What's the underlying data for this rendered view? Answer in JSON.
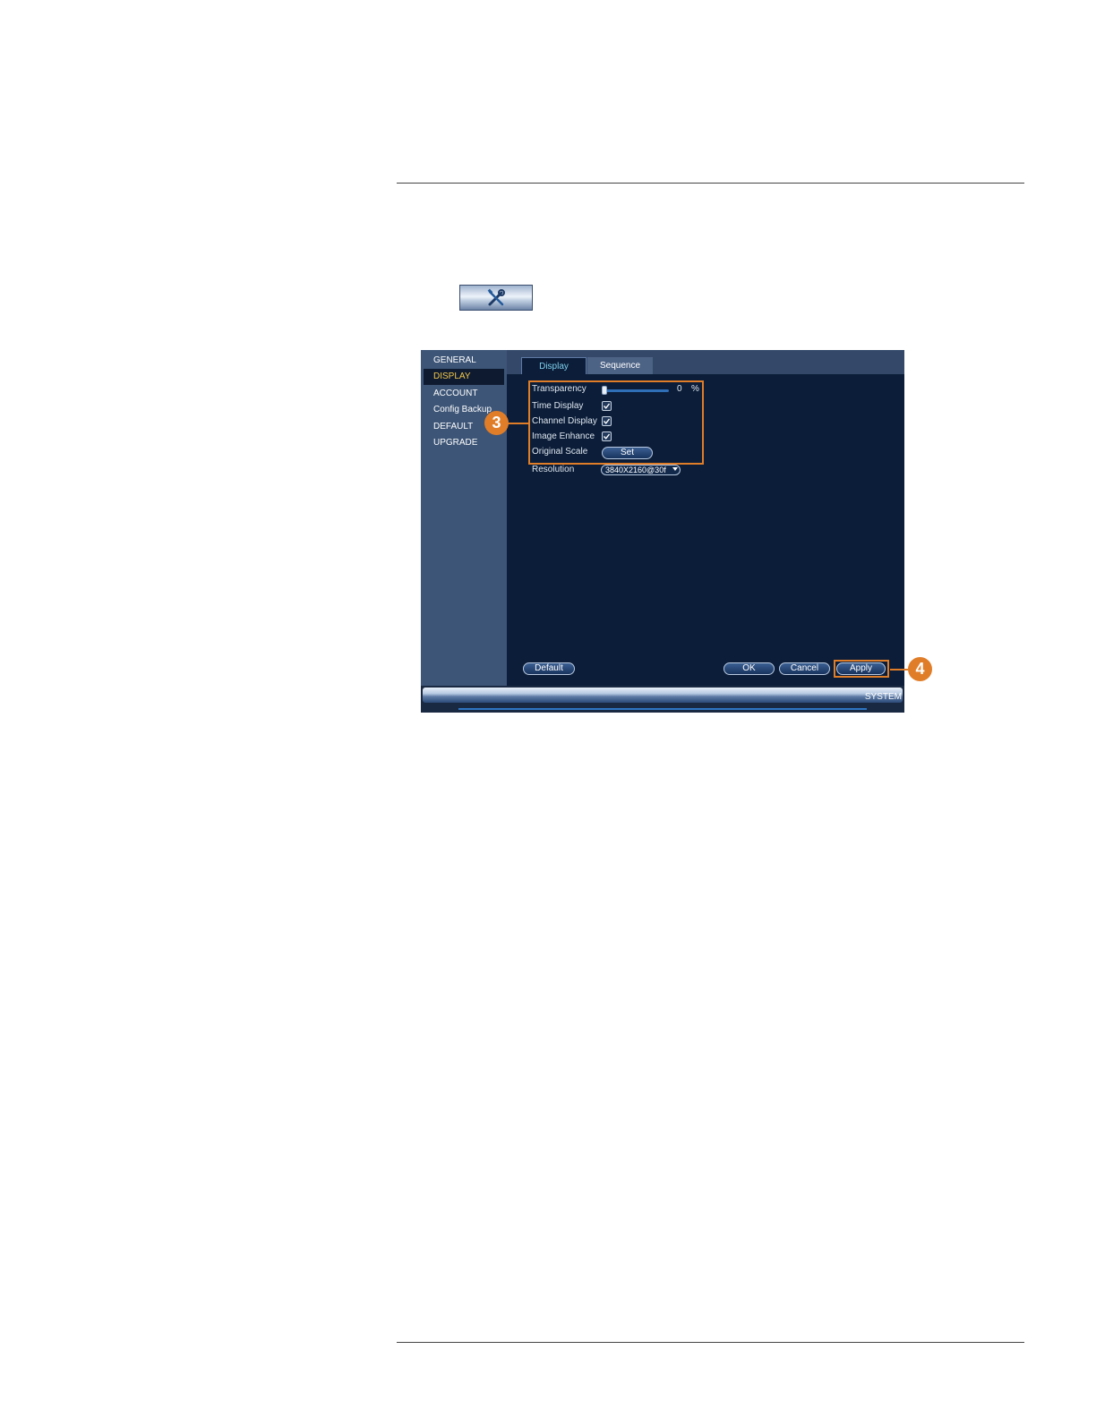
{
  "sidebar": {
    "items": [
      {
        "label": "GENERAL"
      },
      {
        "label": "DISPLAY"
      },
      {
        "label": "ACCOUNT"
      },
      {
        "label": "Config Backup"
      },
      {
        "label": "DEFAULT"
      },
      {
        "label": "UPGRADE"
      }
    ],
    "active": "DISPLAY"
  },
  "tabs": [
    {
      "label": "Display"
    },
    {
      "label": "Sequence"
    }
  ],
  "settings": {
    "transparency": {
      "label": "Transparency",
      "value": "0",
      "unit": "%"
    },
    "time_display": {
      "label": "Time Display",
      "checked": true
    },
    "channel_display": {
      "label": "Channel Display",
      "checked": true
    },
    "image_enhance": {
      "label": "Image Enhance",
      "checked": true
    },
    "original_scale": {
      "label": "Original Scale",
      "button": "Set"
    },
    "resolution": {
      "label": "Resolution",
      "value": "3840X2160@30f"
    }
  },
  "buttons": {
    "default": "Default",
    "ok": "OK",
    "cancel": "Cancel",
    "apply": "Apply"
  },
  "status": {
    "text": "SYSTEM"
  },
  "callouts": [
    "3",
    "4"
  ],
  "colors": {
    "highlight": "#e07d28",
    "active_menu": "#f2c84b",
    "active_tab": "#7fd1ee"
  },
  "icons": {
    "tool_button": "wrench-screwdriver-icon"
  }
}
